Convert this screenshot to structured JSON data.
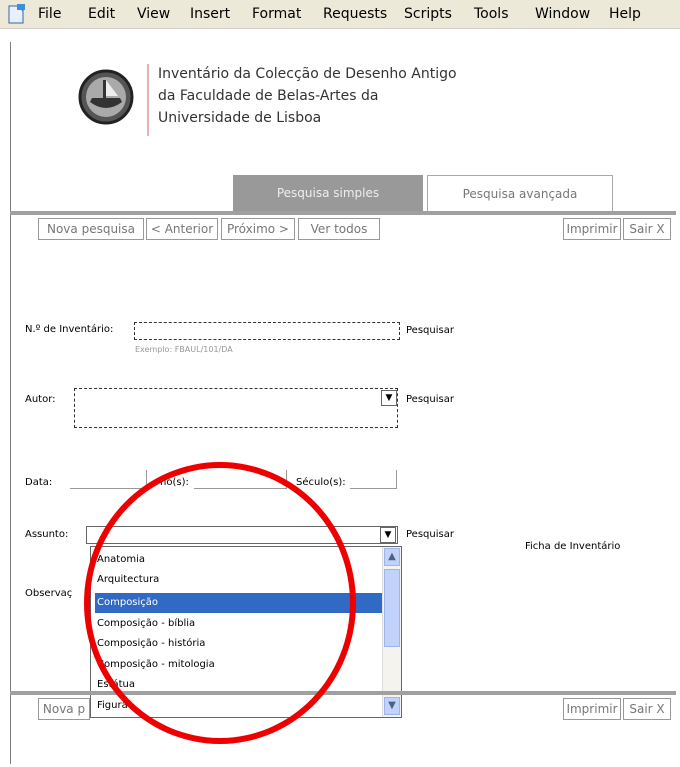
{
  "menubar": {
    "items": [
      "File",
      "Edit",
      "View",
      "Insert",
      "Format",
      "Requests",
      "Scripts",
      "Tools",
      "Window",
      "Help"
    ]
  },
  "institution": {
    "line1": "Inventário da Colecção de Desenho Antigo",
    "line2": "da Faculdade de Belas-Artes da",
    "line3": "Universidade de Lisboa"
  },
  "tabs": {
    "simple": "Pesquisa simples",
    "advanced": "Pesquisa avançada"
  },
  "nav": {
    "new_search": "Nova pesquisa",
    "previous": "< Anterior",
    "next": "Próximo >",
    "view_all": "Ver todos",
    "print": "Imprimir",
    "exit": "Sair X"
  },
  "nav_bottom": {
    "new_search_partial": "Nova p",
    "print": "Imprimir",
    "exit": "Sair X"
  },
  "form": {
    "inventory_label": "N.º de Inventário:",
    "inventory_example": "Exemplo: FBAUL/101/DA",
    "search_label": "Pesquisar",
    "author_label": "Autor:",
    "date_label": "Data:",
    "year_label": "no(s):",
    "century_label": "Século(s):",
    "subject_label": "Assunto:",
    "observations_label_partial": "Observaç",
    "record_link": "Ficha de Inventário"
  },
  "subject_options": [
    "Anatomia",
    "Arquitectura",
    "Composição",
    "Composição - bíblia",
    "Composição - história",
    "Composição - mitologia",
    "Estátua",
    "Figura"
  ],
  "selected_option_index": 2,
  "colors": {
    "selection": "#316ac5",
    "annotation_circle": "#e00000",
    "active_tab": "#999999"
  }
}
